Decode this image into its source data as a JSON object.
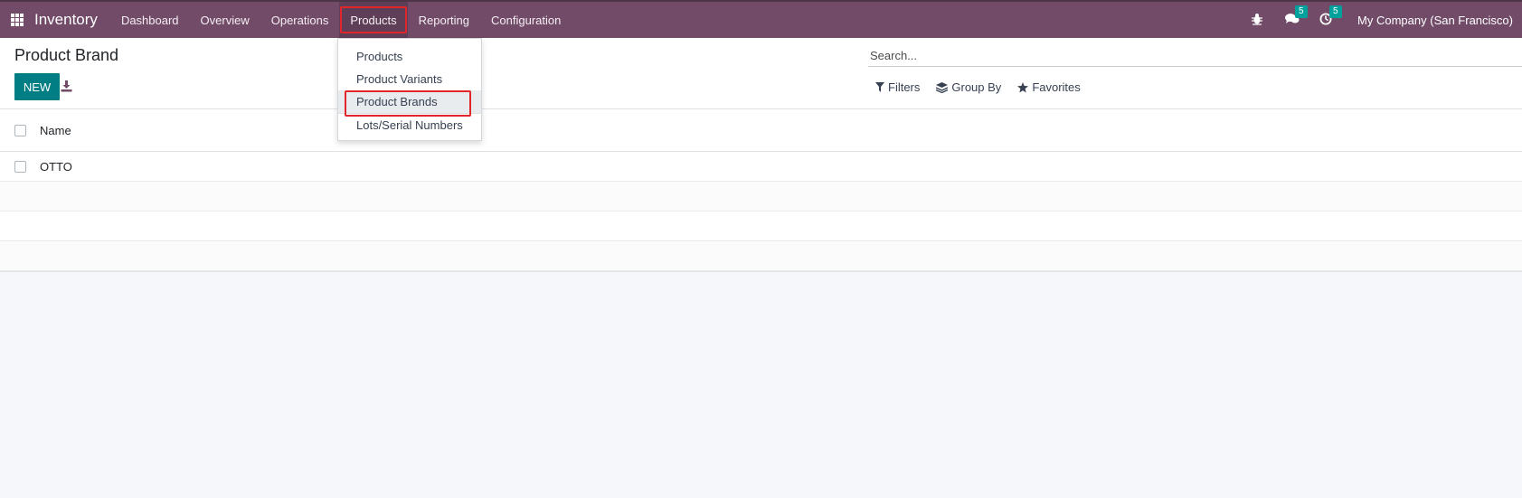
{
  "navbar": {
    "app_name": "Inventory",
    "menu": [
      {
        "label": "Dashboard"
      },
      {
        "label": "Overview"
      },
      {
        "label": "Operations"
      },
      {
        "label": "Products"
      },
      {
        "label": "Reporting"
      },
      {
        "label": "Configuration"
      }
    ],
    "messages_badge": "5",
    "activities_badge": "5",
    "company": "My Company (San Francisco)"
  },
  "control_panel": {
    "title": "Product Brand",
    "new_label": "NEW",
    "search_placeholder": "Search...",
    "filters_label": "Filters",
    "groupby_label": "Group By",
    "favorites_label": "Favorites"
  },
  "list": {
    "column_name": "Name",
    "rows": [
      {
        "name": "OTTO"
      }
    ]
  },
  "products_dropdown": {
    "items": [
      {
        "label": "Products"
      },
      {
        "label": "Product Variants"
      },
      {
        "label": "Product Brands"
      },
      {
        "label": "Lots/Serial Numbers"
      }
    ]
  },
  "colors": {
    "navbar": "#714b67",
    "primary_button": "#017e84",
    "badge": "#00a09d",
    "highlight_box": "#e0262a"
  }
}
